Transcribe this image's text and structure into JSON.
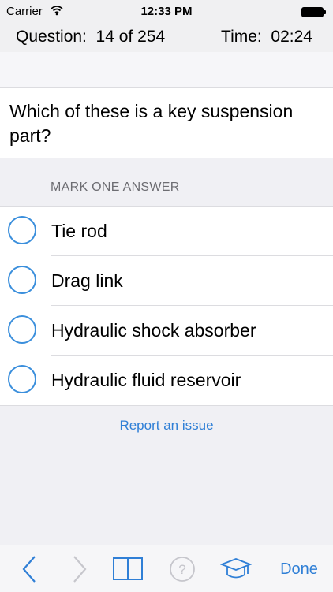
{
  "status_bar": {
    "carrier": "Carrier",
    "time": "12:33 PM",
    "icons": [
      "wifi-icon",
      "battery-icon"
    ]
  },
  "header": {
    "question_counter": "Question:  14 of 254",
    "timer": "Time:  02:24"
  },
  "question": {
    "text": "Which of these is a key suspension part?"
  },
  "answers": {
    "section_header": "MARK ONE ANSWER",
    "options": [
      {
        "label": "Tie rod"
      },
      {
        "label": "Drag link"
      },
      {
        "label": "Hydraulic shock absorber"
      },
      {
        "label": "Hydraulic fluid reservoir"
      }
    ]
  },
  "report_link": "Report an issue",
  "toolbar": {
    "icons": [
      "back-arrow-icon",
      "forward-arrow-icon",
      "book-icon",
      "help-icon",
      "graduation-cap-icon"
    ],
    "done_label": "Done"
  },
  "colors": {
    "accent": "#2f7fd6",
    "radio_border": "#3b8fdc",
    "header_bg": "#f0f0f2"
  }
}
